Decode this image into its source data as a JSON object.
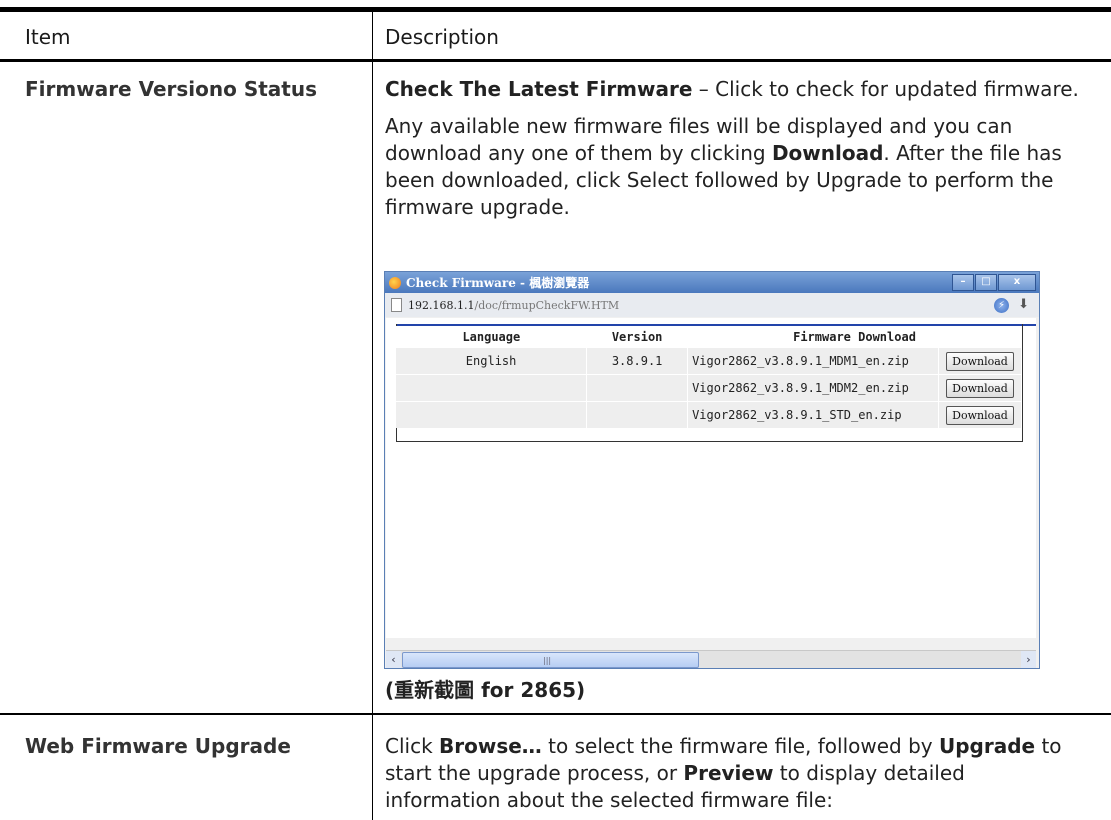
{
  "header": {
    "item": "Item",
    "description": "Description"
  },
  "row1": {
    "item": "Firmware Versiono Status",
    "p1_bold": "Check The Latest Firmware",
    "p1_rest": " – Click to check for updated firmware.",
    "p2_a": "Any available new firmware files will be displayed and you can download any one of them by clicking ",
    "p2_bold": "Download",
    "p2_b": ". After the file has been downloaded, click Select followed by Upgrade to perform the firmware upgrade.",
    "caption": "(重新截圖 for 2865)",
    "window": {
      "title": "Check Firmware - 楓樹瀏覽器",
      "url_host": "192.168.1.1",
      "url_path": "/doc/frmupCheckFW.HTM",
      "columns": [
        "Language",
        "Version",
        "Firmware Download"
      ],
      "rows": [
        {
          "language": "English",
          "version": "3.8.9.1",
          "file": "Vigor2862_v3.8.9.1_MDM1_en.zip",
          "button": "Download"
        },
        {
          "language": "",
          "version": "",
          "file": "Vigor2862_v3.8.9.1_MDM2_en.zip",
          "button": "Download"
        },
        {
          "language": "",
          "version": "",
          "file": "Vigor2862_v3.8.9.1_STD_en.zip",
          "button": "Download"
        }
      ],
      "icons": [
        "browser-logo-icon",
        "minimize-icon",
        "maximize-icon",
        "close-icon",
        "page-icon",
        "extension-icon",
        "download-arrow-icon",
        "scroll-left-icon",
        "scroll-right-icon"
      ]
    }
  },
  "row2": {
    "item": "Web Firmware Upgrade",
    "t1": "Click ",
    "b1": "Browse…",
    "t2": " to select the firmware file, followed by ",
    "b2": "Upgrade",
    "t3": " to start the upgrade process, or ",
    "b3": "Preview",
    "t4": " to display detailed information about the selected firmware file:"
  }
}
